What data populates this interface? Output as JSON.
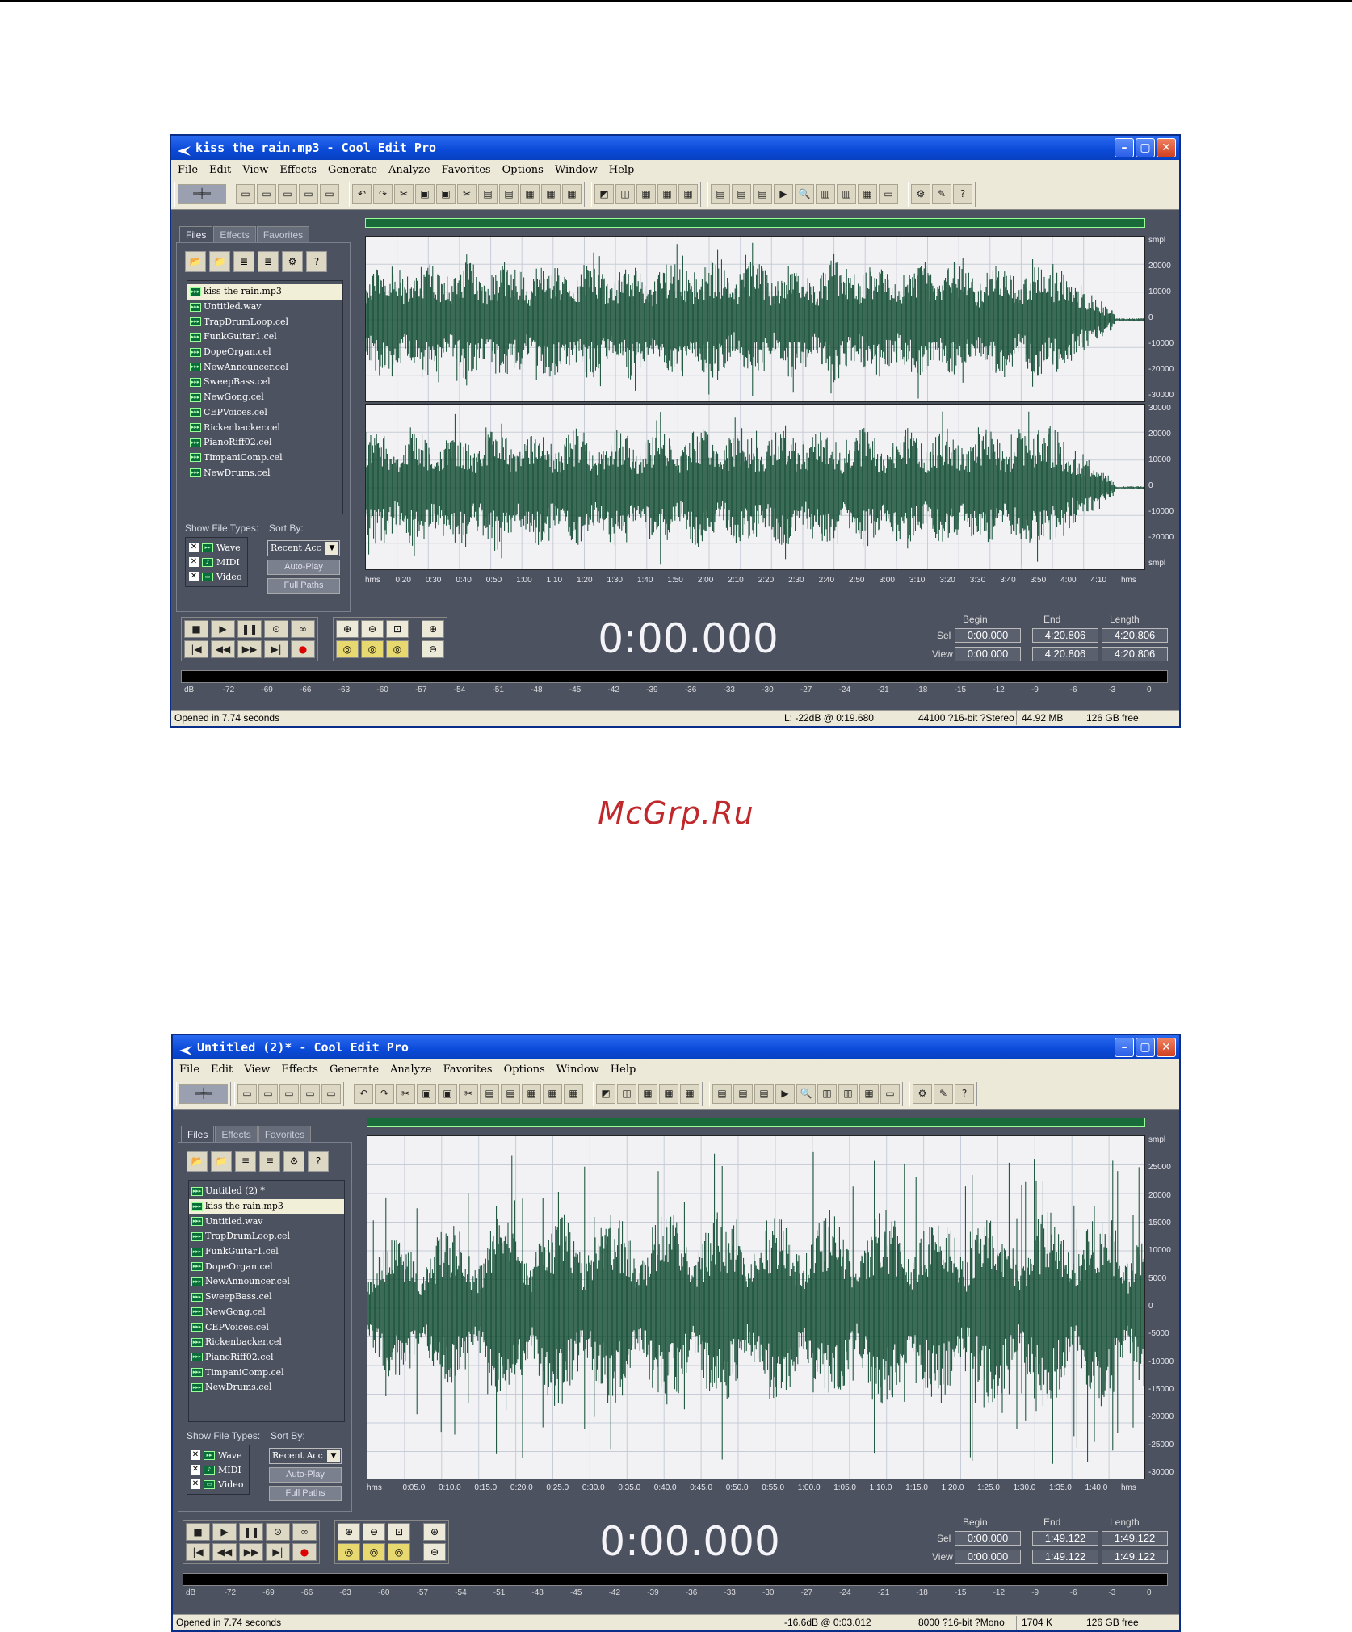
{
  "watermark": "McGrp.Ru",
  "menu": [
    "File",
    "Edit",
    "View",
    "Effects",
    "Generate",
    "Analyze",
    "Favorites",
    "Options",
    "Window",
    "Help"
  ],
  "tabs": [
    "Files",
    "Effects",
    "Favorites"
  ],
  "show_file_types_label": "Show File Types:",
  "sort_by_label": "Sort By:",
  "types": [
    "Wave",
    "MIDI",
    "Video"
  ],
  "sort_value": "Recent Acc",
  "autoplay_label": "Auto-Play",
  "fullpaths_label": "Full Paths",
  "begin_label": "Begin",
  "end_label": "End",
  "length_label": "Length",
  "sel_label": "Sel",
  "view_label": "View",
  "level_scale": [
    "dB",
    "-72",
    "-69",
    "-66",
    "-63",
    "-60",
    "-57",
    "-54",
    "-51",
    "-48",
    "-45",
    "-42",
    "-39",
    "-36",
    "-33",
    "-30",
    "-27",
    "-24",
    "-21",
    "-18",
    "-15",
    "-12",
    "-9",
    "-6",
    "-3",
    "0"
  ],
  "colors": {
    "waveform": "#0e4a30",
    "background": "#4c5260",
    "titlebar": "#0a4ad8"
  },
  "windows": [
    {
      "title": "kiss the rain.mp3 - Cool Edit Pro",
      "files": [
        "kiss the rain.mp3",
        "Untitled.wav",
        "TrapDrumLoop.cel",
        "FunkGuitar1.cel",
        "DopeOrgan.cel",
        "NewAnnouncer.cel",
        "SweepBass.cel",
        "NewGong.cel",
        "CEPVoices.cel",
        "Rickenbacker.cel",
        "PianoRiff02.cel",
        "TimpaniComp.cel",
        "NewDrums.cel"
      ],
      "selected_file": 0,
      "y_axis_top": [
        "smpl",
        "20000",
        "10000",
        "0",
        "-10000",
        "-20000",
        "-30000"
      ],
      "y_axis_bottom": [
        "30000",
        "20000",
        "10000",
        "0",
        "-10000",
        "-20000",
        "smpl"
      ],
      "x_axis": [
        "hms",
        "0:20",
        "0:30",
        "0:40",
        "0:50",
        "1:00",
        "1:10",
        "1:20",
        "1:30",
        "1:40",
        "1:50",
        "2:00",
        "2:10",
        "2:20",
        "2:30",
        "2:40",
        "2:50",
        "3:00",
        "3:10",
        "3:20",
        "3:30",
        "3:40",
        "3:50",
        "4:00",
        "4:10",
        "hms"
      ],
      "time": "0:00.000",
      "sel": {
        "begin": "0:00.000",
        "end": "4:20.806",
        "length": "4:20.806"
      },
      "view": {
        "begin": "0:00.000",
        "end": "4:20.806",
        "length": "4:20.806"
      },
      "status": {
        "message": "Opened in 7.74 seconds",
        "level": "L: -22dB @  0:19.680",
        "format": "44100 ?16-bit ?Stereo",
        "size": "44.92 MB",
        "free": "126 GB free"
      }
    },
    {
      "title": "Untitled (2)* - Cool Edit Pro",
      "files": [
        "Untitled (2) *",
        "kiss the rain.mp3",
        "Untitled.wav",
        "TrapDrumLoop.cel",
        "FunkGuitar1.cel",
        "DopeOrgan.cel",
        "NewAnnouncer.cel",
        "SweepBass.cel",
        "NewGong.cel",
        "CEPVoices.cel",
        "Rickenbacker.cel",
        "PianoRiff02.cel",
        "TimpaniComp.cel",
        "NewDrums.cel"
      ],
      "selected_file": 1,
      "y_axis": [
        "smpl",
        "25000",
        "20000",
        "15000",
        "10000",
        "5000",
        "0",
        "-5000",
        "-10000",
        "-15000",
        "-20000",
        "-25000",
        "-30000"
      ],
      "x_axis": [
        "hms",
        "0:05.0",
        "0:10.0",
        "0:15.0",
        "0:20.0",
        "0:25.0",
        "0:30.0",
        "0:35.0",
        "0:40.0",
        "0:45.0",
        "0:50.0",
        "0:55.0",
        "1:00.0",
        "1:05.0",
        "1:10.0",
        "1:15.0",
        "1:20.0",
        "1:25.0",
        "1:30.0",
        "1:35.0",
        "1:40.0",
        "hms"
      ],
      "time": "0:00.000",
      "sel": {
        "begin": "0:00.000",
        "end": "1:49.122",
        "length": "1:49.122"
      },
      "view": {
        "begin": "0:00.000",
        "end": "1:49.122",
        "length": "1:49.122"
      },
      "status": {
        "message": "Opened in 7.74 seconds",
        "level": "-16.6dB @  0:03.012",
        "format": "8000 ?16-bit ?Mono",
        "size": "1704 K",
        "free": "126 GB free"
      }
    }
  ]
}
